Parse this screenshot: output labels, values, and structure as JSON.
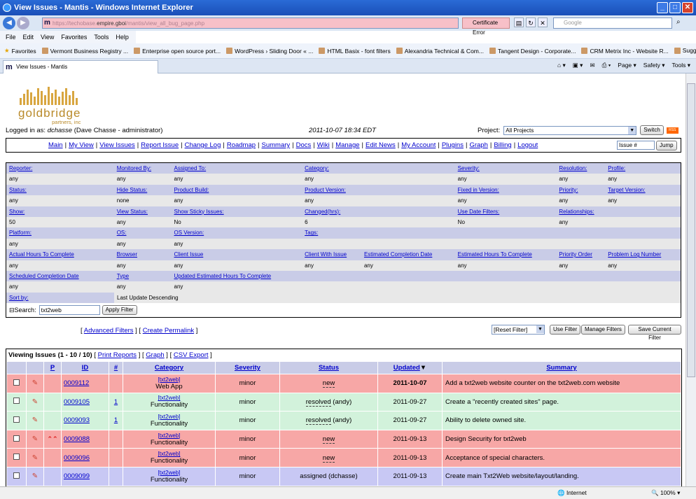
{
  "window": {
    "title": "View Issues - Mantis - Windows Internet Explorer"
  },
  "browser": {
    "url_prefix": "https://techobase.",
    "url_domain": "empire.gboi",
    "url_suffix": "/mantis/view_all_bug_page.php",
    "cert": "Certificate Error",
    "search_placeholder": "Google",
    "menu": [
      "File",
      "Edit",
      "View",
      "Favorites",
      "Tools",
      "Help"
    ],
    "favorites_label": "Favorites",
    "favorites": [
      "Vermont Business Registry ...",
      "Enterprise open source port...",
      "WordPress › Sliding Door « ...",
      "HTML Basix - font filters",
      "Alexandria Technical & Com...",
      "Tangent Design - Corporate...",
      "CRM Metrix Inc - Website R...",
      "Suggested Sites ▾"
    ],
    "tab": "View Issues - Mantis",
    "tools": [
      "Page ▾",
      "Safety ▾",
      "Tools ▾"
    ],
    "status_zone": "Internet",
    "zoom": "100%"
  },
  "logo": {
    "name": "goldbridge",
    "sub": "partners, inc"
  },
  "login": {
    "prefix": "Logged in as:",
    "user": "dchasse",
    "detail": "(Dave Chasse - administrator)",
    "datetime": "2011-10-07 18:34 EDT"
  },
  "project": {
    "label": "Project:",
    "value": "All Projects",
    "switch": "Switch"
  },
  "nav": {
    "items": [
      "Main",
      "My View",
      "View Issues",
      "Report Issue",
      "Change Log",
      "Roadmap",
      "Summary",
      "Docs",
      "Wiki",
      "Manage",
      "Edit News",
      "My Account",
      "Plugins",
      "Graph",
      "Billing",
      "Logout"
    ],
    "issue_placeholder": "Issue #",
    "jump": "Jump"
  },
  "filters": {
    "rows": [
      {
        "h": [
          "Reporter:",
          "Monitored By:",
          "Assigned To:",
          "Category:",
          "Severity:",
          "Resolution:",
          "Profile:"
        ],
        "v": [
          "any",
          "any",
          "any",
          "any",
          "any",
          "any",
          "any"
        ]
      },
      {
        "h": [
          "Status:",
          "Hide Status:",
          "Product Build:",
          "Product Version:",
          "Fixed in Version:",
          "Priority:",
          "Target Version:"
        ],
        "v": [
          "any",
          "none",
          "any",
          "any",
          "any",
          "any",
          "any"
        ]
      },
      {
        "h": [
          "Show:",
          "View Status:",
          "Show Sticky Issues:",
          "Changed(hrs):",
          "Use Date Filters:",
          "Relationships:",
          ""
        ],
        "v": [
          "50",
          "any",
          "No",
          "6",
          "No",
          "any",
          ""
        ]
      },
      {
        "h": [
          "Platform:",
          "OS:",
          "OS Version:",
          "Tags:",
          "",
          "",
          ""
        ],
        "v": [
          "any",
          "any",
          "any",
          "",
          "",
          "",
          ""
        ]
      },
      {
        "h": [
          "Actual Hours To Complete",
          "Browser",
          "Client Issue",
          "Client With Issue",
          "Estimated Completion Date",
          "Estimated Hours To Complete",
          "Priority Order",
          "Problem Log Number"
        ],
        "v": [
          "any",
          "any",
          "any",
          "any",
          "any",
          "any",
          "any",
          "any"
        ]
      },
      {
        "h": [
          "Scheduled Completion Date",
          "Type",
          "Updated Estimated Hours To Complete",
          ""
        ],
        "v": [
          "any",
          "any",
          "any",
          ""
        ]
      },
      {
        "h": [
          "Sort by:",
          "Last Update Descending"
        ],
        "v": []
      }
    ],
    "search_label": "Search:",
    "search_value": "txt2web",
    "apply": "Apply Filter",
    "advanced": "Advanced Filters",
    "permalink": "Create Permalink",
    "reset": "[Reset Filter]",
    "use": "Use Filter",
    "manage": "Manage Filters",
    "save": "Save Current Filter"
  },
  "issues": {
    "title": "Viewing Issues",
    "range": "(1 - 10 / 10)",
    "links": [
      "Print Reports",
      "Graph",
      "CSV Export"
    ],
    "cols": [
      "",
      "",
      "P",
      "ID",
      "#",
      "Category",
      "Severity",
      "Status",
      "Updated",
      "Summary"
    ],
    "rows": [
      {
        "id": "0009112",
        "notes": "",
        "project": "[txt2web]",
        "cat": "Web App",
        "sev": "minor",
        "status": "new",
        "updated": "2011-10-07",
        "summary": "Add a txt2web website counter on the txt2web.com website",
        "prio": "",
        "cls": "r-new",
        "bold": true
      },
      {
        "id": "0009105",
        "notes": "1",
        "project": "[txt2web]",
        "cat": "Functionality",
        "sev": "minor",
        "status": "resolved",
        "handler": " (andy)",
        "updated": "2011-09-27",
        "summary": "Create a \"recently created sites\" page.",
        "prio": "",
        "cls": "r-res"
      },
      {
        "id": "0009093",
        "notes": "1",
        "project": "[txt2web]",
        "cat": "Functionality",
        "sev": "minor",
        "status": "resolved",
        "handler": " (andy)",
        "updated": "2011-09-27",
        "summary": "Ability to delete owned site.",
        "prio": "",
        "cls": "r-res"
      },
      {
        "id": "0009088",
        "notes": "",
        "project": "[txt2web]",
        "cat": "Functionality",
        "sev": "minor",
        "status": "new",
        "updated": "2011-09-13",
        "summary": "Design Security for txt2web",
        "prio": "high",
        "cls": "r-new"
      },
      {
        "id": "0009096",
        "notes": "",
        "project": "[txt2web]",
        "cat": "Functionality",
        "sev": "minor",
        "status": "new",
        "updated": "2011-09-13",
        "summary": "Acceptance of special characters.",
        "prio": "",
        "cls": "r-new"
      },
      {
        "id": "0009099",
        "notes": "",
        "project": "[txt2web]",
        "cat": "Functionality",
        "sev": "minor",
        "status": "assigned (dchasse)",
        "updated": "2011-09-13",
        "summary": "Create main Txt2Web website/layout/landing.",
        "prio": "",
        "cls": "r-asg"
      }
    ]
  }
}
